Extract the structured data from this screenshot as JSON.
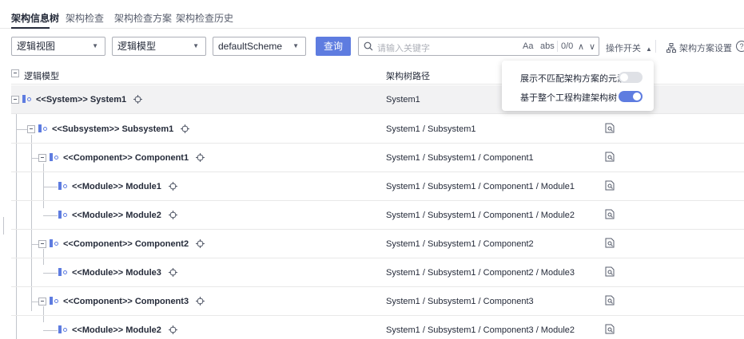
{
  "tabs": [
    {
      "label": "架构信息树",
      "active": true
    },
    {
      "label": "架构检查"
    },
    {
      "label": "架构检查方案"
    },
    {
      "label": "架构检查历史"
    }
  ],
  "toolbar": {
    "view_select": "逻辑视图",
    "model_select": "逻辑模型",
    "scheme_select": "defaultScheme",
    "query_button": "查询",
    "search_placeholder": "请输入关键字",
    "match_case": "Aa",
    "whole_word": "abs",
    "match_count": "0/0",
    "prev_icon": "∧",
    "next_icon": "∨",
    "ops_toggle": "操作开关",
    "scheme_settings": "架构方案设置"
  },
  "table": {
    "headers": {
      "name": "逻辑模型",
      "path": "架构树路径"
    },
    "rows": [
      {
        "name": "<<System>> System1",
        "path": "System1"
      },
      {
        "name": "<<Subsystem>> Subsystem1",
        "path": "System1 / Subsystem1"
      },
      {
        "name": "<<Component>> Component1",
        "path": "System1 / Subsystem1 / Component1"
      },
      {
        "name": "<<Module>> Module1",
        "path": "System1 / Subsystem1 / Component1 / Module1"
      },
      {
        "name": "<<Module>> Module2",
        "path": "System1 / Subsystem1 / Component1 / Module2"
      },
      {
        "name": "<<Component>> Component2",
        "path": "System1 / Subsystem1 / Component2"
      },
      {
        "name": "<<Module>> Module3",
        "path": "System1 / Subsystem1 / Component2 / Module3"
      },
      {
        "name": "<<Component>> Component3",
        "path": "System1 / Subsystem1 / Component3"
      },
      {
        "name": "<<Module>> Module2",
        "path": "System1 / Subsystem1 / Component3 / Module2"
      }
    ]
  },
  "popup": {
    "option1": {
      "label": "展示不匹配架构方案的元素",
      "enabled": false
    },
    "option2": {
      "label": "基于整个工程构建架构树",
      "enabled": true
    }
  },
  "colors": {
    "accent": "#5e7ce0",
    "toggle_off": "#dfe1e6",
    "text": "#252b3a"
  }
}
